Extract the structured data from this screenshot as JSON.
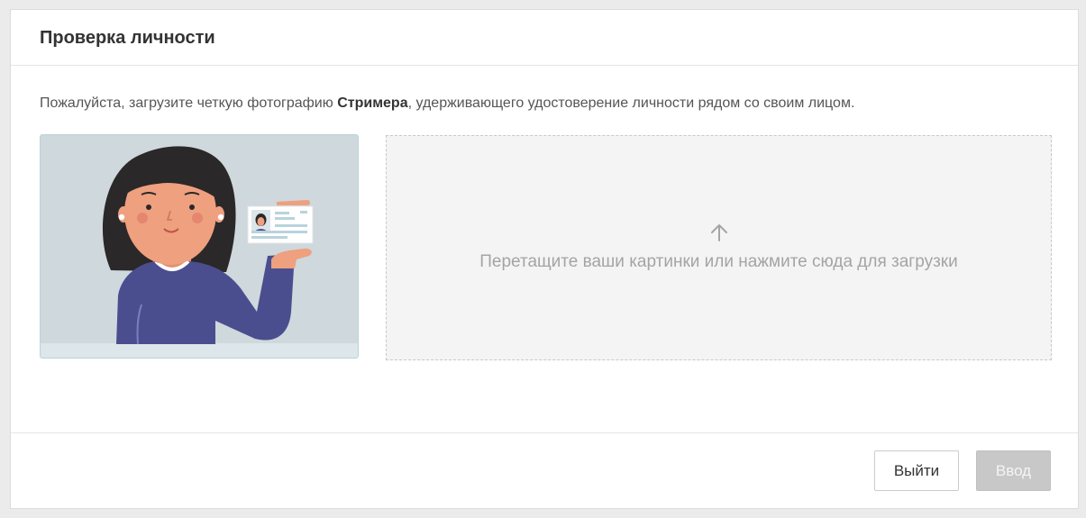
{
  "dialog": {
    "title": "Проверка личности",
    "instructions": {
      "before": "Пожалуйста, загрузите четкую фотографию ",
      "bold": "Стримера",
      "after": ", удерживающего удостоверение личности рядом со своим лицом."
    },
    "dropzone": {
      "icon": "upload-arrow-icon",
      "text": "Перетащите ваши картинки или нажмите сюда для загрузки"
    },
    "buttons": {
      "exit_label": "Выйти",
      "enter_label": "Ввод",
      "enter_disabled": true
    }
  },
  "colors": {
    "title_text": "#333333",
    "dropzone_bg": "#f4f4f4",
    "dropzone_text": "#a4a4a4",
    "disabled_button": "#c8c8c8",
    "illustration_bg": "#cfd8dc",
    "sweater": "#4a4e8f",
    "skin": "#eea07f",
    "hair": "#2b2829"
  }
}
